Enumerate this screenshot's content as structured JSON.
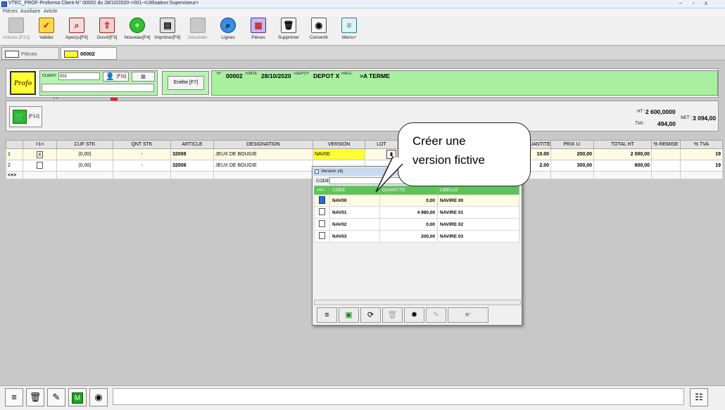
{
  "window": {
    "title": "VTEC_PROF-Proforma Client-N° 00002 du 28/10/2020->001-<Utilisateur:Superviseur>",
    "minimize": "–",
    "maximize": "▫",
    "close": "x"
  },
  "menu": [
    "Pièces",
    "Auxiliaire",
    "Article"
  ],
  "toolbar": [
    {
      "label": "Articles [F12]",
      "icon": "articles-icon",
      "glyph": "",
      "disabled": true
    },
    {
      "label": "Valider",
      "icon": "validate-check-icon",
      "glyph": "✓",
      "disabled": false
    },
    {
      "label": "Aperçu[F8]",
      "icon": "preview-magnifier-icon",
      "glyph": "⌕",
      "disabled": false
    },
    {
      "label": "Ouvrir[F3]",
      "icon": "open-arrow-icon",
      "glyph": "⇧",
      "disabled": false
    },
    {
      "label": "Nouveau[F4]",
      "icon": "new-plus-icon",
      "glyph": "+",
      "disabled": false
    },
    {
      "label": "Imprimer[F9]",
      "icon": "printer-icon",
      "glyph": "▤",
      "disabled": false
    },
    {
      "label": "Dévalider",
      "icon": "unvalidate-icon",
      "glyph": "",
      "disabled": true
    },
    {
      "label": "Lignes",
      "icon": "lines-search-icon",
      "glyph": "⌕",
      "disabled": false
    },
    {
      "label": "Pièces",
      "icon": "pieces-grid-icon",
      "glyph": "▦",
      "disabled": false
    },
    {
      "label": "Supprimer",
      "icon": "delete-trash-icon",
      "glyph": "🗑",
      "disabled": false
    },
    {
      "label": "Convertir",
      "icon": "convert-eye-icon",
      "glyph": "◉",
      "disabled": false
    },
    {
      "label": "Menu+",
      "icon": "menu-lines-icon",
      "glyph": "≡",
      "disabled": false
    }
  ],
  "tabs": [
    {
      "label": "Pièces",
      "active": false
    },
    {
      "label": "00002",
      "active": true
    }
  ],
  "header": {
    "logo_text": "Profo",
    "client_label": "CLIENT:",
    "client_value": "001",
    "client_key": "[F11]",
    "entete_button": "Entête [F7]",
    "num_label": "N°",
    "num_value": "00002",
    "date_label": ">DATE",
    "date_value": "28/10/2020",
    "depot_label": ">DEPOT",
    "depot_value": "DEPOT X",
    "reg_label": ">REG.",
    "reg_value": ">A TERME"
  },
  "totals": {
    "cart_key": "[F12]",
    "ht_label": "HT :",
    "ht_value": "2 600,0000",
    "tva_label": "TVA :",
    "tva_value": "494,00",
    "net_label": "NET :",
    "net_value": "3 094,00"
  },
  "grid": {
    "columns": [
      ">1<",
      "CUF STK",
      "QNT STK",
      "ARTICLE",
      "DESIGNATION",
      "VERSION",
      "LOT",
      "",
      "QUANTITE",
      "PRIX U.",
      "TOTAL HT",
      "% REMISE",
      "% TVA"
    ],
    "rows": [
      {
        "num": "1",
        "check": "X",
        "cuf": "(0,00)",
        "qnt": "-",
        "article": "32008",
        "designation": "JEUX DE BOUGIE",
        "version": "NAV00",
        "quantite": "10.00",
        "prix": "200,00",
        "total": "2 000,00",
        "tva": "19"
      },
      {
        "num": "2",
        "check": "",
        "cuf": "(0,00)",
        "qnt": "-",
        "article": "32008",
        "designation": "JEUX DE BOUGIE",
        "version": "",
        "quantite": "2.00",
        "prix": "300,00",
        "total": "600,00",
        "tva": "19"
      }
    ],
    "new_row_marker": "<+>"
  },
  "popup": {
    "title": "Version (4)",
    "code_label": "CODE:",
    "columns": [
      ">0<",
      "CODE",
      "QUANTITE",
      "LIBELLE"
    ],
    "rows": [
      {
        "code": "NAV00",
        "quantite": "0,00",
        "libelle": "NAVIRE 00"
      },
      {
        "code": "NAV01",
        "quantite": "4 980,00",
        "libelle": "NAVIRE 01"
      },
      {
        "code": "NAV02",
        "quantite": "0,00",
        "libelle": "NAVIRE 02"
      },
      {
        "code": "NAV03",
        "quantite": "200,00",
        "libelle": "NAVIRE 03"
      }
    ]
  },
  "callout": {
    "line1": "Créer une",
    "line2": "version fictive"
  },
  "colors": {
    "accent_green": "#a8f0a0",
    "grid_green": "#5ec25a",
    "selection_yellow": "#ffff33"
  }
}
